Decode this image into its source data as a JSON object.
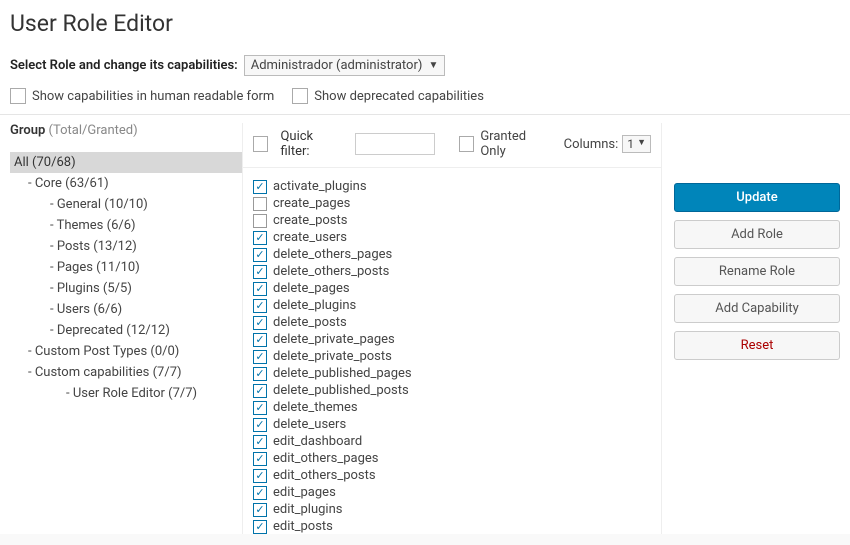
{
  "page_title": "User Role Editor",
  "select_role_label": "Select Role and change its capabilities:",
  "selected_role": "Administrador (administrator)",
  "show_human": "Show capabilities in human readable form",
  "show_deprecated": "Show deprecated capabilities",
  "group_header": {
    "label": "Group",
    "counts": "(Total/Granted)"
  },
  "groups": {
    "all": "All (70/68)",
    "core": "Core (63/61)",
    "general": "General (10/10)",
    "themes": "Themes (6/6)",
    "posts": "Posts (13/12)",
    "pages": "Pages (11/10)",
    "plugins": "Plugins (5/5)",
    "users": "Users (6/6)",
    "deprecated": "Deprecated (12/12)",
    "custom_post_types": "Custom Post Types (0/0)",
    "custom_caps": "Custom capabilities (7/7)",
    "ure": "User Role Editor (7/7)"
  },
  "filter": {
    "quick_filter_label": "Quick filter:",
    "granted_only": "Granted Only",
    "columns_label": "Columns:",
    "columns_value": "1"
  },
  "capabilities": [
    {
      "label": "activate_plugins",
      "checked": true
    },
    {
      "label": "create_pages",
      "checked": false
    },
    {
      "label": "create_posts",
      "checked": false
    },
    {
      "label": "create_users",
      "checked": true
    },
    {
      "label": "delete_others_pages",
      "checked": true
    },
    {
      "label": "delete_others_posts",
      "checked": true
    },
    {
      "label": "delete_pages",
      "checked": true
    },
    {
      "label": "delete_plugins",
      "checked": true
    },
    {
      "label": "delete_posts",
      "checked": true
    },
    {
      "label": "delete_private_pages",
      "checked": true
    },
    {
      "label": "delete_private_posts",
      "checked": true
    },
    {
      "label": "delete_published_pages",
      "checked": true
    },
    {
      "label": "delete_published_posts",
      "checked": true
    },
    {
      "label": "delete_themes",
      "checked": true
    },
    {
      "label": "delete_users",
      "checked": true
    },
    {
      "label": "edit_dashboard",
      "checked": true
    },
    {
      "label": "edit_others_pages",
      "checked": true
    },
    {
      "label": "edit_others_posts",
      "checked": true
    },
    {
      "label": "edit_pages",
      "checked": true
    },
    {
      "label": "edit_plugins",
      "checked": true
    },
    {
      "label": "edit_posts",
      "checked": true
    }
  ],
  "buttons": {
    "update": "Update",
    "add_role": "Add Role",
    "rename_role": "Rename Role",
    "add_capability": "Add Capability",
    "reset": "Reset"
  }
}
